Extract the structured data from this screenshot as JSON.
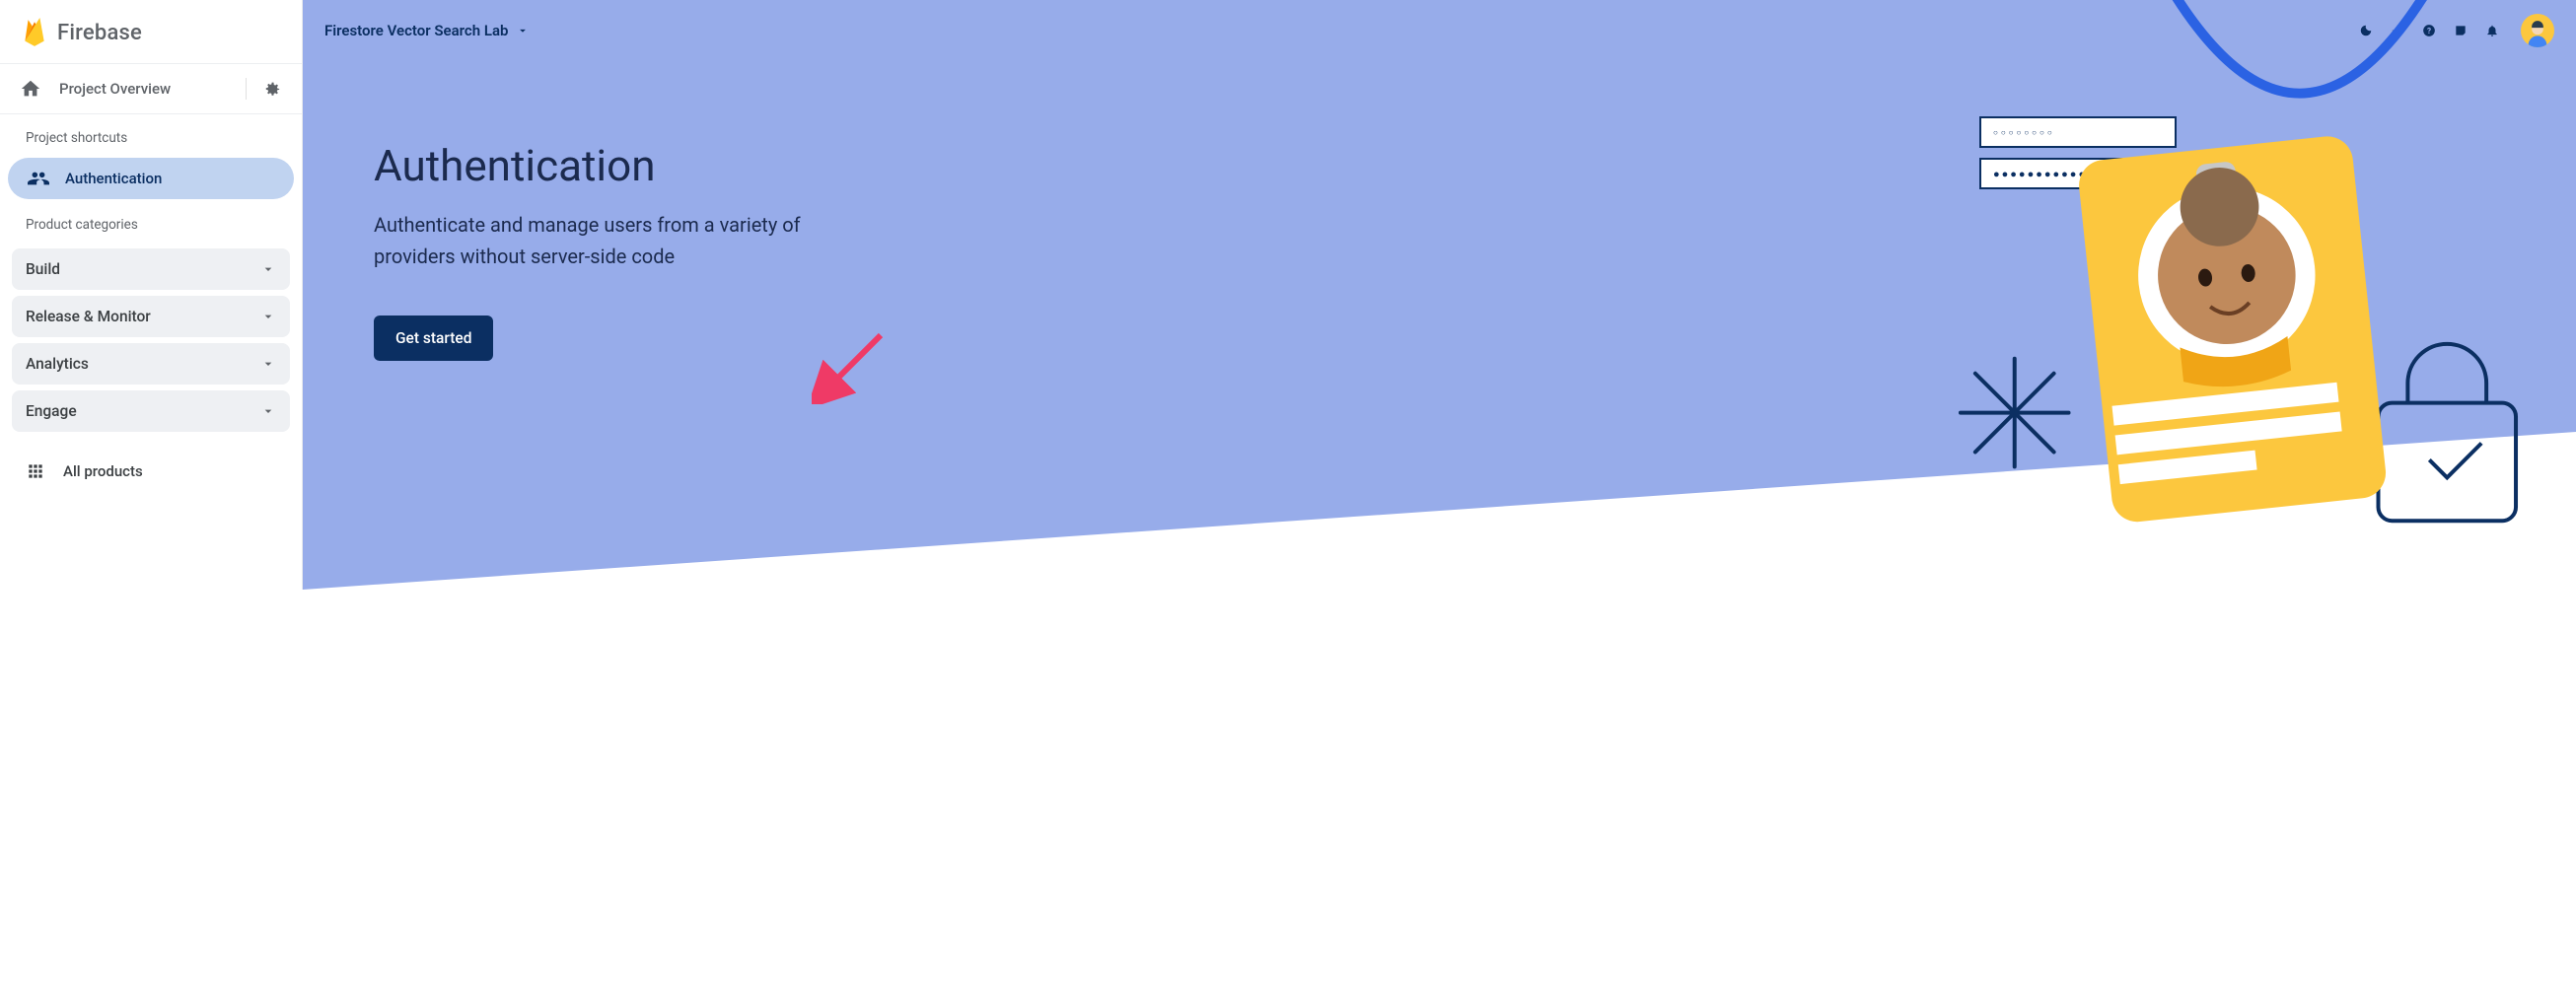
{
  "brand": "Firebase",
  "sidebar": {
    "overview": "Project Overview",
    "shortcuts_label": "Project shortcuts",
    "shortcut_items": [
      {
        "label": "Authentication",
        "active": true
      }
    ],
    "categories_label": "Product categories",
    "categories": [
      {
        "label": "Build"
      },
      {
        "label": "Release & Monitor"
      },
      {
        "label": "Analytics"
      },
      {
        "label": "Engage"
      }
    ],
    "all_products": "All products"
  },
  "topbar": {
    "project_name": "Firestore Vector Search Lab"
  },
  "hero": {
    "title": "Authentication",
    "subtitle": "Authenticate and manage users from a variety of providers without server-side code",
    "cta": "Get started"
  },
  "illustration": {
    "field1_placeholder": "○○○○○○○○",
    "field2_placeholder": "●●●●●●●●●●●●●●"
  },
  "colors": {
    "accent_blue": "#97acea",
    "dark_navy": "#0b2f62",
    "badge_yellow": "#fcc73e",
    "strap_blue": "#2b62e3"
  }
}
